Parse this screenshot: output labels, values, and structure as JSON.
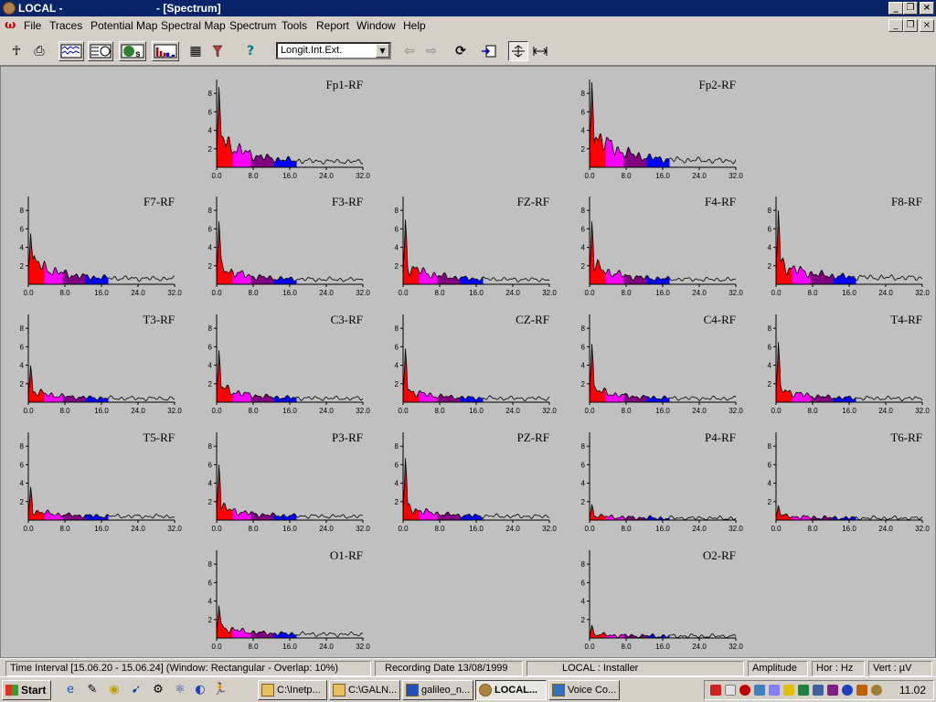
{
  "window": {
    "app_name": "LOCAL -",
    "doc_name": "- [Spectrum]",
    "controls": {
      "minimize": "_",
      "restore": "❐",
      "close": "×"
    }
  },
  "menu": {
    "items": [
      "File",
      "Traces",
      "Potential Map",
      "Spectral Map",
      "Spectrum",
      "Tools",
      "Report",
      "Window",
      "Help"
    ]
  },
  "toolbar": {
    "montage_value": "Longit.Int.Ext."
  },
  "chart_data": {
    "type": "area",
    "x_ticks": [
      "0.0",
      "8.0",
      "16.0",
      "24.0",
      "32.0"
    ],
    "y_ticks": [
      "2",
      "4",
      "6",
      "8"
    ],
    "xlim": [
      0,
      32
    ],
    "ylim": [
      0,
      9.5
    ],
    "band_colors": [
      "#ff0000",
      "#ff00ff",
      "#800080",
      "#0000ff"
    ],
    "band_edges": [
      0,
      3.5,
      7.5,
      12.5,
      17.5
    ],
    "channels": [
      {
        "label": "Fp1-RF",
        "peak": 8.7,
        "mid": 3.2,
        "tail": 0.6
      },
      {
        "label": "Fp2-RF",
        "peak": 9.2,
        "mid": 3.8,
        "tail": 0.7
      },
      {
        "label": "F7-RF",
        "peak": 5.5,
        "mid": 2.5,
        "tail": 0.6
      },
      {
        "label": "F3-RF",
        "peak": 6.8,
        "mid": 1.8,
        "tail": 0.5
      },
      {
        "label": "FZ-RF",
        "peak": 7.0,
        "mid": 2.0,
        "tail": 0.5
      },
      {
        "label": "F4-RF",
        "peak": 6.8,
        "mid": 2.0,
        "tail": 0.5
      },
      {
        "label": "F8-RF",
        "peak": 8.0,
        "mid": 2.3,
        "tail": 0.7
      },
      {
        "label": "T3-RF",
        "peak": 4.0,
        "mid": 1.2,
        "tail": 0.4
      },
      {
        "label": "C3-RF",
        "peak": 5.6,
        "mid": 1.6,
        "tail": 0.4
      },
      {
        "label": "CZ-RF",
        "peak": 5.8,
        "mid": 1.3,
        "tail": 0.4
      },
      {
        "label": "C4-RF",
        "peak": 6.3,
        "mid": 1.4,
        "tail": 0.4
      },
      {
        "label": "T4-RF",
        "peak": 6.5,
        "mid": 1.4,
        "tail": 0.4
      },
      {
        "label": "T5-RF",
        "peak": 3.6,
        "mid": 1.0,
        "tail": 0.4
      },
      {
        "label": "P3-RF",
        "peak": 6.0,
        "mid": 1.4,
        "tail": 0.4
      },
      {
        "label": "PZ-RF",
        "peak": 6.7,
        "mid": 1.4,
        "tail": 0.4
      },
      {
        "label": "P4-RF",
        "peak": 1.7,
        "mid": 0.5,
        "tail": 0.2
      },
      {
        "label": "T6-RF",
        "peak": 1.6,
        "mid": 0.5,
        "tail": 0.2
      },
      {
        "label": "O1-RF",
        "peak": 3.5,
        "mid": 1.2,
        "tail": 0.4
      },
      {
        "label": "O2-RF",
        "peak": 1.4,
        "mid": 0.4,
        "tail": 0.2
      }
    ]
  },
  "status": {
    "time_interval": "Time Interval [15.06.20 - 15.06.24] (Window: Rectangular - Overlap: 10%)",
    "recording_date": "Recording Date 13/08/1999",
    "user": "LOCAL : Installer",
    "measure": "Amplitude",
    "hor_unit": "Hor : Hz",
    "vert_unit": "Vert : µV"
  },
  "taskbar": {
    "start_label": "Start",
    "tasks": [
      "C:\\Inetp...",
      "C:\\GALN...",
      "galileo_n...",
      "LOCAL...",
      "Voice Co..."
    ],
    "clock": "11.02"
  }
}
